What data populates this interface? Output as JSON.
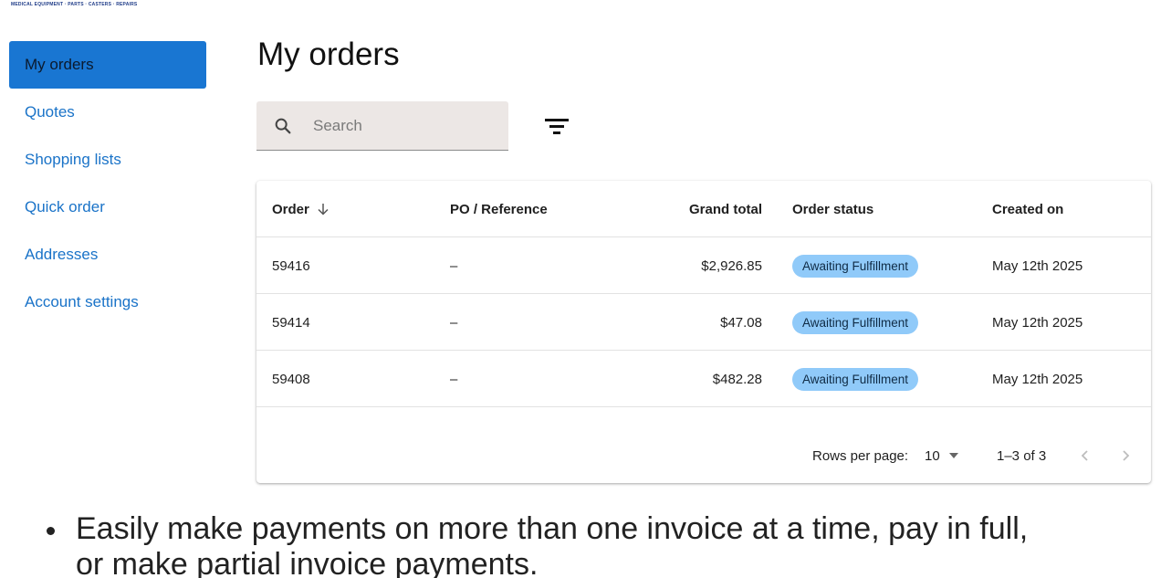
{
  "brand": {
    "tagline": "MEDICAL EQUIPMENT · PARTS · CASTERS · REPAIRS"
  },
  "sidebar": {
    "items": [
      {
        "label": "My orders",
        "active": true
      },
      {
        "label": "Quotes"
      },
      {
        "label": "Shopping lists"
      },
      {
        "label": "Quick order"
      },
      {
        "label": "Addresses"
      },
      {
        "label": "Account settings"
      }
    ]
  },
  "main": {
    "title": "My orders",
    "search": {
      "placeholder": "Search",
      "value": ""
    },
    "table": {
      "columns": {
        "order": "Order",
        "po": "PO / Reference",
        "total": "Grand total",
        "status": "Order status",
        "created": "Created on"
      },
      "rows": [
        {
          "order": "59416",
          "po": "–",
          "total": "$2,926.85",
          "status": "Awaiting Fulfillment",
          "created": "May 12th 2025"
        },
        {
          "order": "59414",
          "po": "–",
          "total": "$47.08",
          "status": "Awaiting Fulfillment",
          "created": "May 12th 2025"
        },
        {
          "order": "59408",
          "po": "–",
          "total": "$482.28",
          "status": "Awaiting Fulfillment",
          "created": "May 12th 2025"
        }
      ]
    },
    "pagination": {
      "rows_per_page_label": "Rows per page:",
      "rows_per_page": "10",
      "range": "1–3 of 3"
    }
  },
  "caption": {
    "line1": "Easily make payments on more than one invoice at a time, pay in full,",
    "line2": "or make partial invoice payments."
  },
  "colors": {
    "active_nav": "#1976d2",
    "nav_link": "#1a73c8",
    "status_badge": "#90caf9",
    "search_bg": "#ece7e5"
  },
  "icons": [
    "search-icon",
    "filter-icon",
    "sort-arrow-down-icon",
    "dropdown-triangle-icon",
    "chevron-left-icon",
    "chevron-right-icon"
  ]
}
